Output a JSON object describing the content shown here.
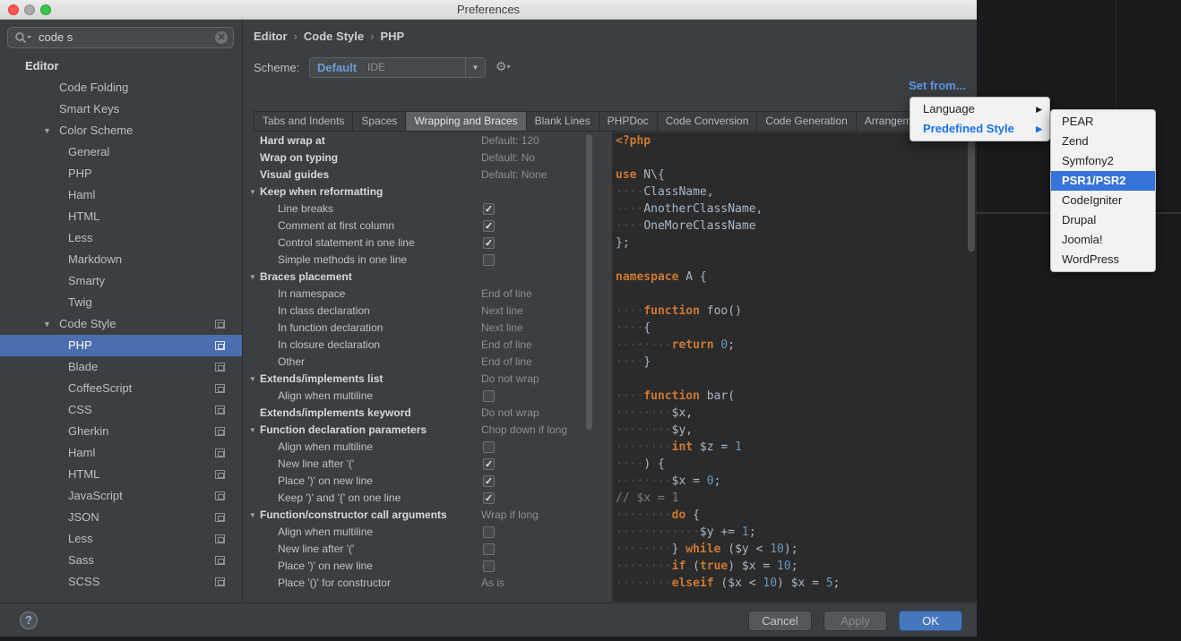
{
  "window": {
    "title": "Preferences"
  },
  "colors": {
    "selection_accent": "#4b6eaf",
    "menu_selection": "#3674d9",
    "link_blue": "#5794e8",
    "keyword_orange": "#cc7832",
    "number_blue": "#6897bb",
    "comment_gray": "#7d7d7d",
    "editor_background": "#2b2b2b",
    "dialog_background": "#3c3f41"
  },
  "sidebar": {
    "search": {
      "value": "code s"
    },
    "tree": [
      {
        "label": "Editor",
        "level": 0,
        "bold": true
      },
      {
        "label": "Code Folding",
        "level": 1
      },
      {
        "label": "Smart Keys",
        "level": 1
      },
      {
        "label": "Color Scheme",
        "level": 1,
        "expanded": true
      },
      {
        "label": "General",
        "level": 2
      },
      {
        "label": "PHP",
        "level": 2
      },
      {
        "label": "Haml",
        "level": 2
      },
      {
        "label": "HTML",
        "level": 2
      },
      {
        "label": "Less",
        "level": 2
      },
      {
        "label": "Markdown",
        "level": 2
      },
      {
        "label": "Smarty",
        "level": 2
      },
      {
        "label": "Twig",
        "level": 2
      },
      {
        "label": "Code Style",
        "level": 1,
        "expanded": true,
        "badge": true
      },
      {
        "label": "PHP",
        "level": 2,
        "selected": true,
        "badge": true
      },
      {
        "label": "Blade",
        "level": 2,
        "badge": true
      },
      {
        "label": "CoffeeScript",
        "level": 2,
        "badge": true
      },
      {
        "label": "CSS",
        "level": 2,
        "badge": true
      },
      {
        "label": "Gherkin",
        "level": 2,
        "badge": true
      },
      {
        "label": "Haml",
        "level": 2,
        "badge": true
      },
      {
        "label": "HTML",
        "level": 2,
        "badge": true
      },
      {
        "label": "JavaScript",
        "level": 2,
        "badge": true
      },
      {
        "label": "JSON",
        "level": 2,
        "badge": true
      },
      {
        "label": "Less",
        "level": 2,
        "badge": true
      },
      {
        "label": "Sass",
        "level": 2,
        "badge": true
      },
      {
        "label": "SCSS",
        "level": 2,
        "badge": true
      }
    ]
  },
  "header": {
    "breadcrumb": [
      "Editor",
      "Code Style",
      "PHP"
    ],
    "scheme_label": "Scheme:",
    "scheme_value": "Default",
    "scheme_suffix": "IDE",
    "set_from": "Set from..."
  },
  "tabs": {
    "items": [
      "Tabs and Indents",
      "Spaces",
      "Wrapping and Braces",
      "Blank Lines",
      "PHPDoc",
      "Code Conversion",
      "Code Generation",
      "Arrangement"
    ],
    "active": "Wrapping and Braces"
  },
  "settings_rows": [
    {
      "label": "Hard wrap at",
      "bold": true,
      "value": "Default: 120"
    },
    {
      "label": "Wrap on typing",
      "bold": true,
      "value": "Default: No"
    },
    {
      "label": "Visual guides",
      "bold": true,
      "value": "Default: None"
    },
    {
      "label": "Keep when reformatting",
      "bold": true,
      "arrow": true
    },
    {
      "label": "Line breaks",
      "child": true,
      "check": true
    },
    {
      "label": "Comment at first column",
      "child": true,
      "check": true
    },
    {
      "label": "Control statement in one line",
      "child": true,
      "check": true
    },
    {
      "label": "Simple methods in one line",
      "child": true,
      "check": false
    },
    {
      "label": "Braces placement",
      "bold": true,
      "arrow": true
    },
    {
      "label": "In namespace",
      "child": true,
      "value": "End of line"
    },
    {
      "label": "In class declaration",
      "child": true,
      "value": "Next line"
    },
    {
      "label": "In function declaration",
      "child": true,
      "value": "Next line"
    },
    {
      "label": "In closure declaration",
      "child": true,
      "value": "End of line"
    },
    {
      "label": "Other",
      "child": true,
      "value": "End of line"
    },
    {
      "label": "Extends/implements list",
      "bold": true,
      "arrow": true,
      "value": "Do not wrap"
    },
    {
      "label": "Align when multiline",
      "child": true,
      "check": false
    },
    {
      "label": "Extends/implements keyword",
      "bold": true,
      "value": "Do not wrap"
    },
    {
      "label": "Function declaration parameters",
      "bold": true,
      "arrow": true,
      "value": "Chop down if long"
    },
    {
      "label": "Align when multiline",
      "child": true,
      "check": false
    },
    {
      "label": "New line after '('",
      "child": true,
      "check": true
    },
    {
      "label": "Place ')' on new line",
      "child": true,
      "check": true
    },
    {
      "label": "Keep ')' and '{' on one line",
      "child": true,
      "check": true
    },
    {
      "label": "Function/constructor call arguments",
      "bold": true,
      "arrow": true,
      "value": "Wrap if long"
    },
    {
      "label": "Align when multiline",
      "child": true,
      "check": false
    },
    {
      "label": "New line after '('",
      "child": true,
      "check": false
    },
    {
      "label": "Place ')' on new line",
      "child": true,
      "check": false
    },
    {
      "label": "Place '()' for constructor",
      "child": true,
      "value": "As is"
    }
  ],
  "popup_menu": {
    "items": [
      {
        "label": "Language",
        "active": false
      },
      {
        "label": "Predefined Style",
        "active": true
      }
    ]
  },
  "style_menu": {
    "items": [
      "PEAR",
      "Zend",
      "Symfony2",
      "PSR1/PSR2",
      "CodeIgniter",
      "Drupal",
      "Joomla!",
      "WordPress"
    ],
    "selected": "PSR1/PSR2"
  },
  "code_preview": {
    "lines": [
      [
        [
          "k",
          "<?php"
        ]
      ],
      [],
      [
        [
          "k",
          "use"
        ],
        [
          "t",
          " N\\{"
        ]
      ],
      [
        [
          "w",
          "····"
        ],
        [
          "t",
          "ClassName,"
        ]
      ],
      [
        [
          "w",
          "····"
        ],
        [
          "t",
          "AnotherClassName,"
        ]
      ],
      [
        [
          "w",
          "····"
        ],
        [
          "t",
          "OneMoreClassName"
        ]
      ],
      [
        [
          "t",
          "};"
        ]
      ],
      [],
      [
        [
          "k",
          "namespace"
        ],
        [
          "t",
          " A {"
        ]
      ],
      [],
      [
        [
          "w",
          "····"
        ],
        [
          "k",
          "function"
        ],
        [
          "t",
          " foo()"
        ]
      ],
      [
        [
          "w",
          "····"
        ],
        [
          "t",
          "{"
        ]
      ],
      [
        [
          "w",
          "········"
        ],
        [
          "k",
          "return"
        ],
        [
          "t",
          " "
        ],
        [
          "n",
          "0"
        ],
        [
          "t",
          ";"
        ]
      ],
      [
        [
          "w",
          "····"
        ],
        [
          "t",
          "}"
        ]
      ],
      [],
      [
        [
          "w",
          "····"
        ],
        [
          "k",
          "function"
        ],
        [
          "t",
          " bar("
        ]
      ],
      [
        [
          "w",
          "········"
        ],
        [
          "t",
          "$x,"
        ]
      ],
      [
        [
          "w",
          "········"
        ],
        [
          "t",
          "$y,"
        ]
      ],
      [
        [
          "w",
          "········"
        ],
        [
          "k",
          "int"
        ],
        [
          "t",
          " $z = "
        ],
        [
          "n",
          "1"
        ]
      ],
      [
        [
          "w",
          "····"
        ],
        [
          "t",
          ") {"
        ]
      ],
      [
        [
          "w",
          "········"
        ],
        [
          "t",
          "$x = "
        ],
        [
          "n",
          "0"
        ],
        [
          "t",
          ";"
        ]
      ],
      [
        [
          "c",
          "// $x = 1"
        ]
      ],
      [
        [
          "w",
          "········"
        ],
        [
          "k",
          "do"
        ],
        [
          "t",
          " {"
        ]
      ],
      [
        [
          "w",
          "············"
        ],
        [
          "t",
          "$y += "
        ],
        [
          "n",
          "1"
        ],
        [
          "t",
          ";"
        ]
      ],
      [
        [
          "w",
          "········"
        ],
        [
          "t",
          "} "
        ],
        [
          "k",
          "while"
        ],
        [
          "t",
          " ($y < "
        ],
        [
          "n",
          "10"
        ],
        [
          "t",
          ");"
        ]
      ],
      [
        [
          "w",
          "········"
        ],
        [
          "k",
          "if"
        ],
        [
          "t",
          " ("
        ],
        [
          "k",
          "true"
        ],
        [
          "t",
          ") $x = "
        ],
        [
          "n",
          "10"
        ],
        [
          "t",
          ";"
        ]
      ],
      [
        [
          "w",
          "········"
        ],
        [
          "k",
          "elseif"
        ],
        [
          "t",
          " ($x < "
        ],
        [
          "n",
          "10"
        ],
        [
          "t",
          ") $x = "
        ],
        [
          "n",
          "5"
        ],
        [
          "t",
          ";"
        ]
      ]
    ]
  },
  "footer": {
    "help": "?",
    "cancel": "Cancel",
    "apply": "Apply",
    "ok": "OK"
  }
}
